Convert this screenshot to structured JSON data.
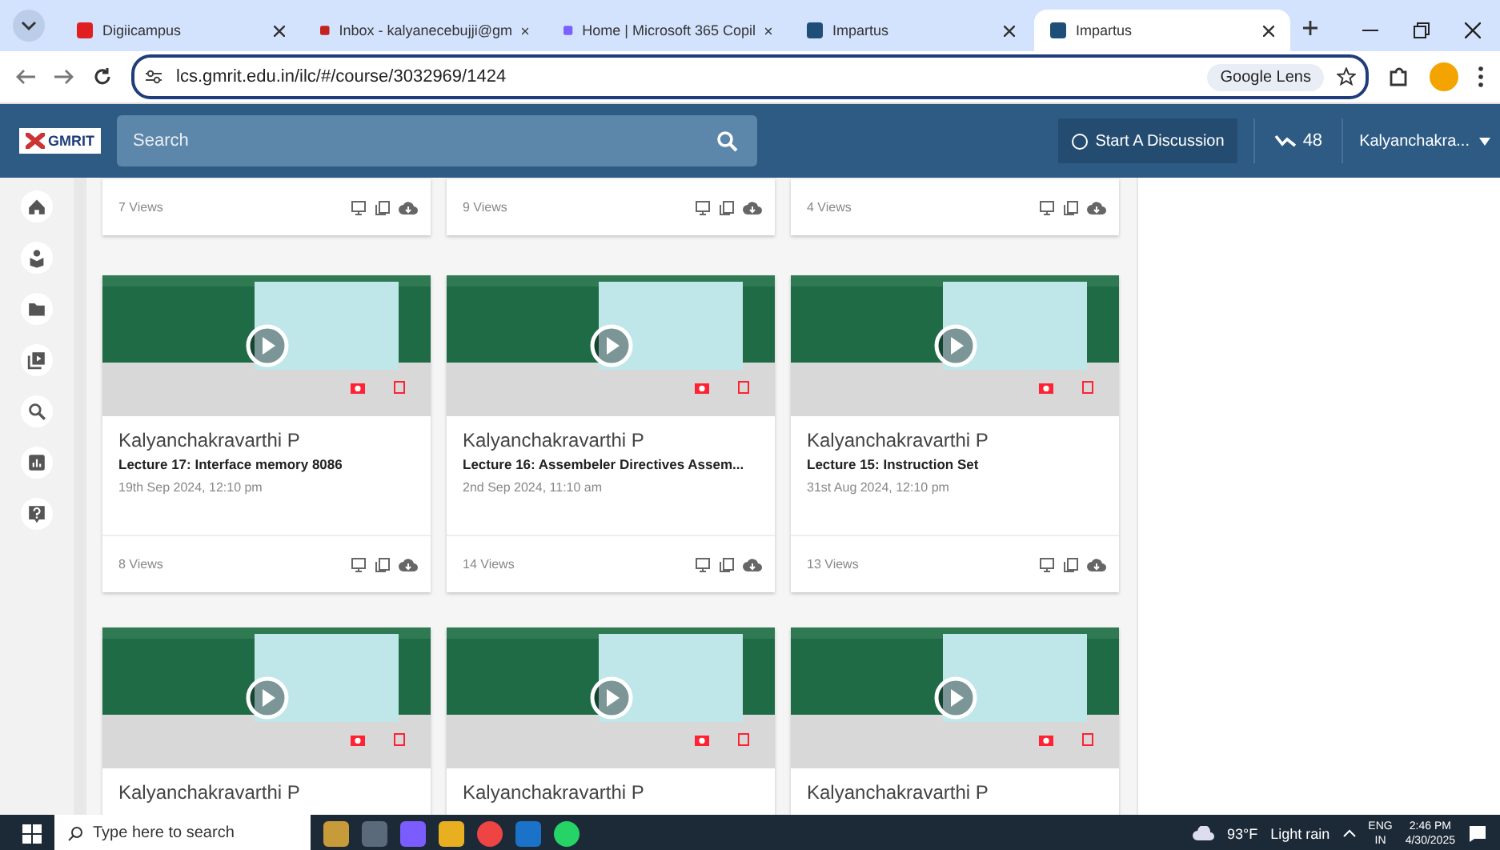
{
  "browser": {
    "tabs": [
      {
        "title": "Digiicampus",
        "selected": false
      },
      {
        "title": "Inbox - kalyanecebujji@gm",
        "selected": false
      },
      {
        "title": "Home | Microsoft 365 Copil",
        "selected": false
      },
      {
        "title": "Impartus",
        "selected": false
      },
      {
        "title": "Impartus",
        "selected": true
      }
    ],
    "url": "lcs.gmrit.edu.in/ilc/#/course/3032969/1424",
    "lens_label": "Google Lens"
  },
  "header": {
    "logo": "GMRIT",
    "search_placeholder": "Search",
    "discussion_button": "Start A Discussion",
    "count": "48",
    "user": "Kalyanchakra..."
  },
  "sidebar": {
    "items": [
      {
        "kind": "home"
      },
      {
        "kind": "courses"
      },
      {
        "kind": "folder"
      },
      {
        "kind": "video"
      },
      {
        "kind": "search"
      },
      {
        "kind": "chart"
      },
      {
        "kind": "help"
      }
    ]
  },
  "top_row": [
    {
      "views": "7 Views"
    },
    {
      "views": "9 Views"
    },
    {
      "views": "4 Views"
    }
  ],
  "lectures": [
    {
      "author": "Kalyanchakravarthi P",
      "title": "Lecture 17: Interface memory 8086",
      "date": "19th Sep 2024, 12:10 pm",
      "views": "8 Views"
    },
    {
      "author": "Kalyanchakravarthi P",
      "title": "Lecture 16: Assembeler Directives Assem...",
      "date": "2nd Sep 2024, 11:10 am",
      "views": "14 Views"
    },
    {
      "author": "Kalyanchakravarthi P",
      "title": "Lecture 15: Instruction Set",
      "date": "31st Aug 2024, 12:10 pm",
      "views": "13 Views"
    }
  ],
  "bottom_row": [
    {
      "author": "Kalyanchakravarthi P"
    },
    {
      "author": "Kalyanchakravarthi P"
    },
    {
      "author": "Kalyanchakravarthi P"
    }
  ],
  "taskbar": {
    "search_placeholder": "Type here to search",
    "temperature": "93°F",
    "weather": "Light rain",
    "language": "ENG",
    "region": "IN",
    "time": "2:46 PM",
    "date": "4/30/2025"
  }
}
